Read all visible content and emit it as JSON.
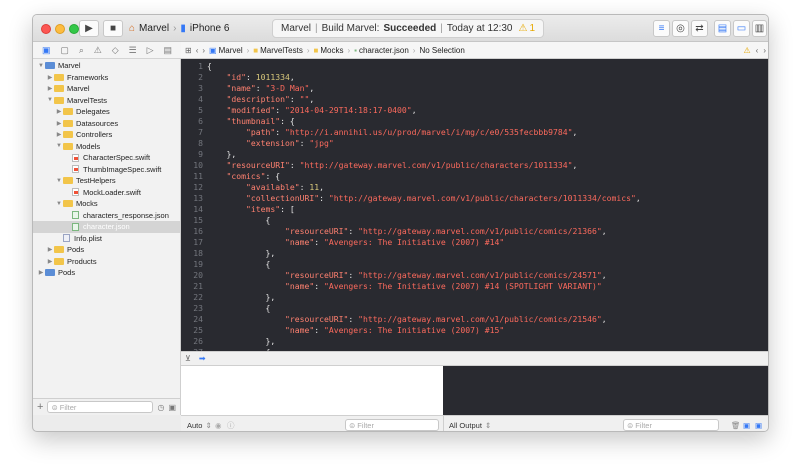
{
  "toolbar": {
    "scheme_target": "Marvel",
    "device": "iPhone 6",
    "status_project": "Marvel",
    "status_action": "Build Marvel:",
    "status_result": "Succeeded",
    "status_time": "Today at 12:30",
    "warning_count": "1"
  },
  "jumpbar": {
    "crumbs": [
      "Marvel",
      "MarvelTests",
      "Mocks",
      "character.json",
      "No Selection"
    ],
    "warning_count": "1"
  },
  "sidebar": {
    "items": [
      {
        "label": "Marvel",
        "depth": 0,
        "expanded": true,
        "kind": "project"
      },
      {
        "label": "Frameworks",
        "depth": 1,
        "expanded": false,
        "kind": "folder"
      },
      {
        "label": "Marvel",
        "depth": 1,
        "expanded": false,
        "kind": "folder"
      },
      {
        "label": "MarvelTests",
        "depth": 1,
        "expanded": true,
        "kind": "folder"
      },
      {
        "label": "Delegates",
        "depth": 2,
        "expanded": false,
        "kind": "folder"
      },
      {
        "label": "Datasources",
        "depth": 2,
        "expanded": false,
        "kind": "folder"
      },
      {
        "label": "Controllers",
        "depth": 2,
        "expanded": false,
        "kind": "folder"
      },
      {
        "label": "Models",
        "depth": 2,
        "expanded": true,
        "kind": "folder"
      },
      {
        "label": "CharacterSpec.swift",
        "depth": 3,
        "kind": "swift"
      },
      {
        "label": "ThumbImageSpec.swift",
        "depth": 3,
        "kind": "swift"
      },
      {
        "label": "TestHelpers",
        "depth": 2,
        "expanded": true,
        "kind": "folder"
      },
      {
        "label": "MockLoader.swift",
        "depth": 3,
        "kind": "swift"
      },
      {
        "label": "Mocks",
        "depth": 2,
        "expanded": true,
        "kind": "folder"
      },
      {
        "label": "characters_response.json",
        "depth": 3,
        "kind": "json"
      },
      {
        "label": "character.json",
        "depth": 3,
        "kind": "json",
        "selected": true
      },
      {
        "label": "Info.plist",
        "depth": 2,
        "kind": "plist"
      },
      {
        "label": "Pods",
        "depth": 1,
        "expanded": false,
        "kind": "folder"
      },
      {
        "label": "Products",
        "depth": 1,
        "expanded": false,
        "kind": "folder"
      },
      {
        "label": "Pods",
        "depth": 0,
        "expanded": false,
        "kind": "project"
      }
    ],
    "filter_placeholder": "Filter"
  },
  "editor": {
    "lines": [
      {
        "n": 1,
        "t": "{"
      },
      {
        "n": 2,
        "t": "    \"id\": 1011334,"
      },
      {
        "n": 3,
        "t": "    \"name\": \"3-D Man\","
      },
      {
        "n": 4,
        "t": "    \"description\": \"\","
      },
      {
        "n": 5,
        "t": "    \"modified\": \"2014-04-29T14:18:17-0400\","
      },
      {
        "n": 6,
        "t": "    \"thumbnail\": {"
      },
      {
        "n": 7,
        "t": "        \"path\": \"http://i.annihil.us/u/prod/marvel/i/mg/c/e0/535fecbbb9784\","
      },
      {
        "n": 8,
        "t": "        \"extension\": \"jpg\""
      },
      {
        "n": 9,
        "t": "    },"
      },
      {
        "n": 10,
        "t": "    \"resourceURI\": \"http://gateway.marvel.com/v1/public/characters/1011334\","
      },
      {
        "n": 11,
        "t": "    \"comics\": {"
      },
      {
        "n": 12,
        "t": "        \"available\": 11,"
      },
      {
        "n": 13,
        "t": "        \"collectionURI\": \"http://gateway.marvel.com/v1/public/characters/1011334/comics\","
      },
      {
        "n": 14,
        "t": "        \"items\": ["
      },
      {
        "n": 15,
        "t": "            {"
      },
      {
        "n": 16,
        "t": "                \"resourceURI\": \"http://gateway.marvel.com/v1/public/comics/21366\","
      },
      {
        "n": 17,
        "t": "                \"name\": \"Avengers: The Initiative (2007) #14\""
      },
      {
        "n": 18,
        "t": "            },"
      },
      {
        "n": 19,
        "t": "            {"
      },
      {
        "n": 20,
        "t": "                \"resourceURI\": \"http://gateway.marvel.com/v1/public/comics/24571\","
      },
      {
        "n": 21,
        "t": "                \"name\": \"Avengers: The Initiative (2007) #14 (SPOTLIGHT VARIANT)\""
      },
      {
        "n": 22,
        "t": "            },"
      },
      {
        "n": 23,
        "t": "            {"
      },
      {
        "n": 24,
        "t": "                \"resourceURI\": \"http://gateway.marvel.com/v1/public/comics/21546\","
      },
      {
        "n": 25,
        "t": "                \"name\": \"Avengers: The Initiative (2007) #15\""
      },
      {
        "n": 26,
        "t": "            },"
      },
      {
        "n": 27,
        "t": "            {"
      }
    ]
  },
  "debug": {
    "variables_scope": "Auto",
    "variables_filter_placeholder": "Filter",
    "console_scope": "All Output",
    "console_filter_placeholder": "Filter"
  },
  "colors": {
    "editor_bg": "#292a30",
    "key": "#ff8170",
    "string": "#fc6a5d",
    "number": "#d9c97c",
    "accent": "#3478f6"
  }
}
